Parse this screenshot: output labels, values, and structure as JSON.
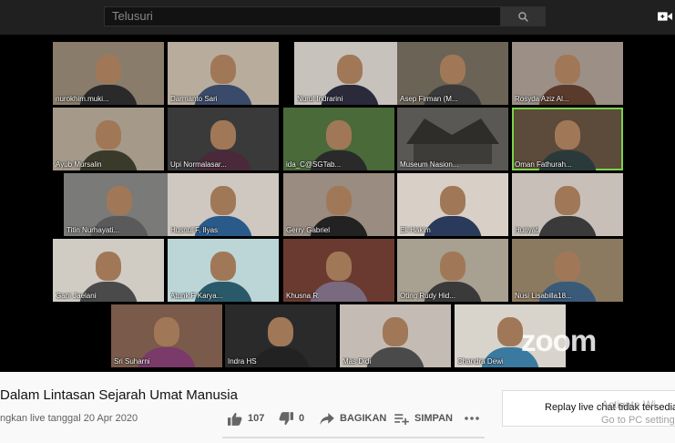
{
  "search": {
    "placeholder": "Telusuri"
  },
  "icons": {
    "search": "search-icon",
    "camera": "video-camera-icon",
    "like": "thumbs-up-icon",
    "dislike": "thumbs-down-icon",
    "share": "share-icon",
    "save": "playlist-add-icon",
    "more": "more-icon"
  },
  "participants": [
    "nurokhim.muki...",
    "Darmanto Sari",
    "Nurul Indrarini",
    "Asep Firman (M...",
    "Rosyda Aziz Al...",
    "Ayub Mursalin",
    "Upi Normalasar...",
    "ida_C@SGTab...",
    "Museum Nasion...",
    "Oman Fathurah...",
    "Titin Nurhayati...",
    "Husnul F. Ilyas",
    "Gerry Gabriel",
    "Eli Hakim",
    "Huriyati",
    "Gani Jaelani",
    "Atunk F Karya...",
    "Khusna R",
    "Oting Rudy Hid...",
    "Nusi Lisabilla18...",
    "Sri Suharni",
    "Indra HS",
    "Mas Didi",
    "Chandra Dewi"
  ],
  "zoom_logo": "zoom",
  "video": {
    "title": "Dalam Lintasan Sejarah Umat Manusia",
    "date": "ngkan live tanggal 20 Apr 2020",
    "likes": "107",
    "dislikes": "0",
    "share_label": "BAGIKAN",
    "save_label": "SIMPAN"
  },
  "chat": {
    "replay_text": "Replay live chat tidak tersedia u"
  },
  "activation": {
    "line1": "Activate Wi",
    "line2": "Go to PC setting"
  },
  "colors": {
    "topbar": "#202020",
    "active_speaker": "#7bd24a",
    "page_bg": "#f9f9f9"
  }
}
